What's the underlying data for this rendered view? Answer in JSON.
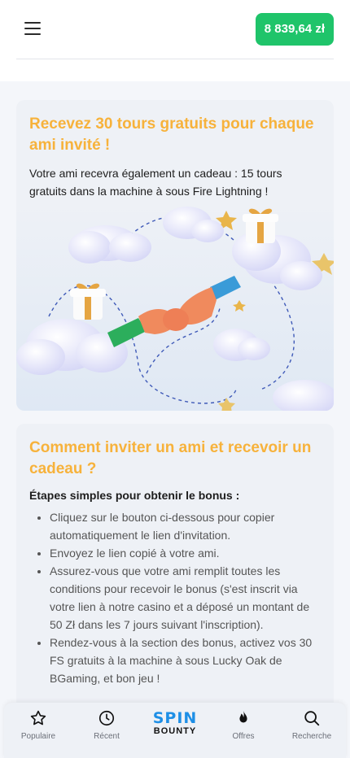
{
  "header": {
    "balance": "8 839,64 zł"
  },
  "promo": {
    "title": "Recevez 30 tours gratuits pour chaque ami invité !",
    "description": "Votre ami recevra également un cadeau : 15 tours gratuits dans la machine à sous Fire Lightning !"
  },
  "howto": {
    "title": "Comment inviter un ami et recevoir un cadeau ?",
    "subhead": "Étapes simples pour obtenir le bonus :",
    "steps": [
      "Cliquez sur le bouton ci-dessous pour copier automatiquement le lien d'invitation.",
      "Envoyez le lien copié à votre ami.",
      "Assurez-vous que votre ami remplit toutes les conditions pour recevoir le bonus (s'est inscrit via votre lien à notre casino et a déposé un montant de 50 Zł dans les 7 jours suivant l'inscription).",
      "Rendez-vous à la section des bonus, activez vos 30 FS gratuits à la machine à sous Lucky Oak de BGaming, et bon jeu !"
    ]
  },
  "nav": {
    "popular": "Populaire",
    "recent": "Récent",
    "logo_top": "SPIN",
    "logo_bottom": "BOUNTY",
    "offers": "Offres",
    "search": "Recherche"
  },
  "colors": {
    "accent": "#f7b23b",
    "balance_bg": "#1fc46a",
    "logo_blue": "#1e8fe6"
  },
  "icons": [
    "menu-icon",
    "star-icon",
    "clock-icon",
    "fire-icon",
    "search-icon"
  ]
}
